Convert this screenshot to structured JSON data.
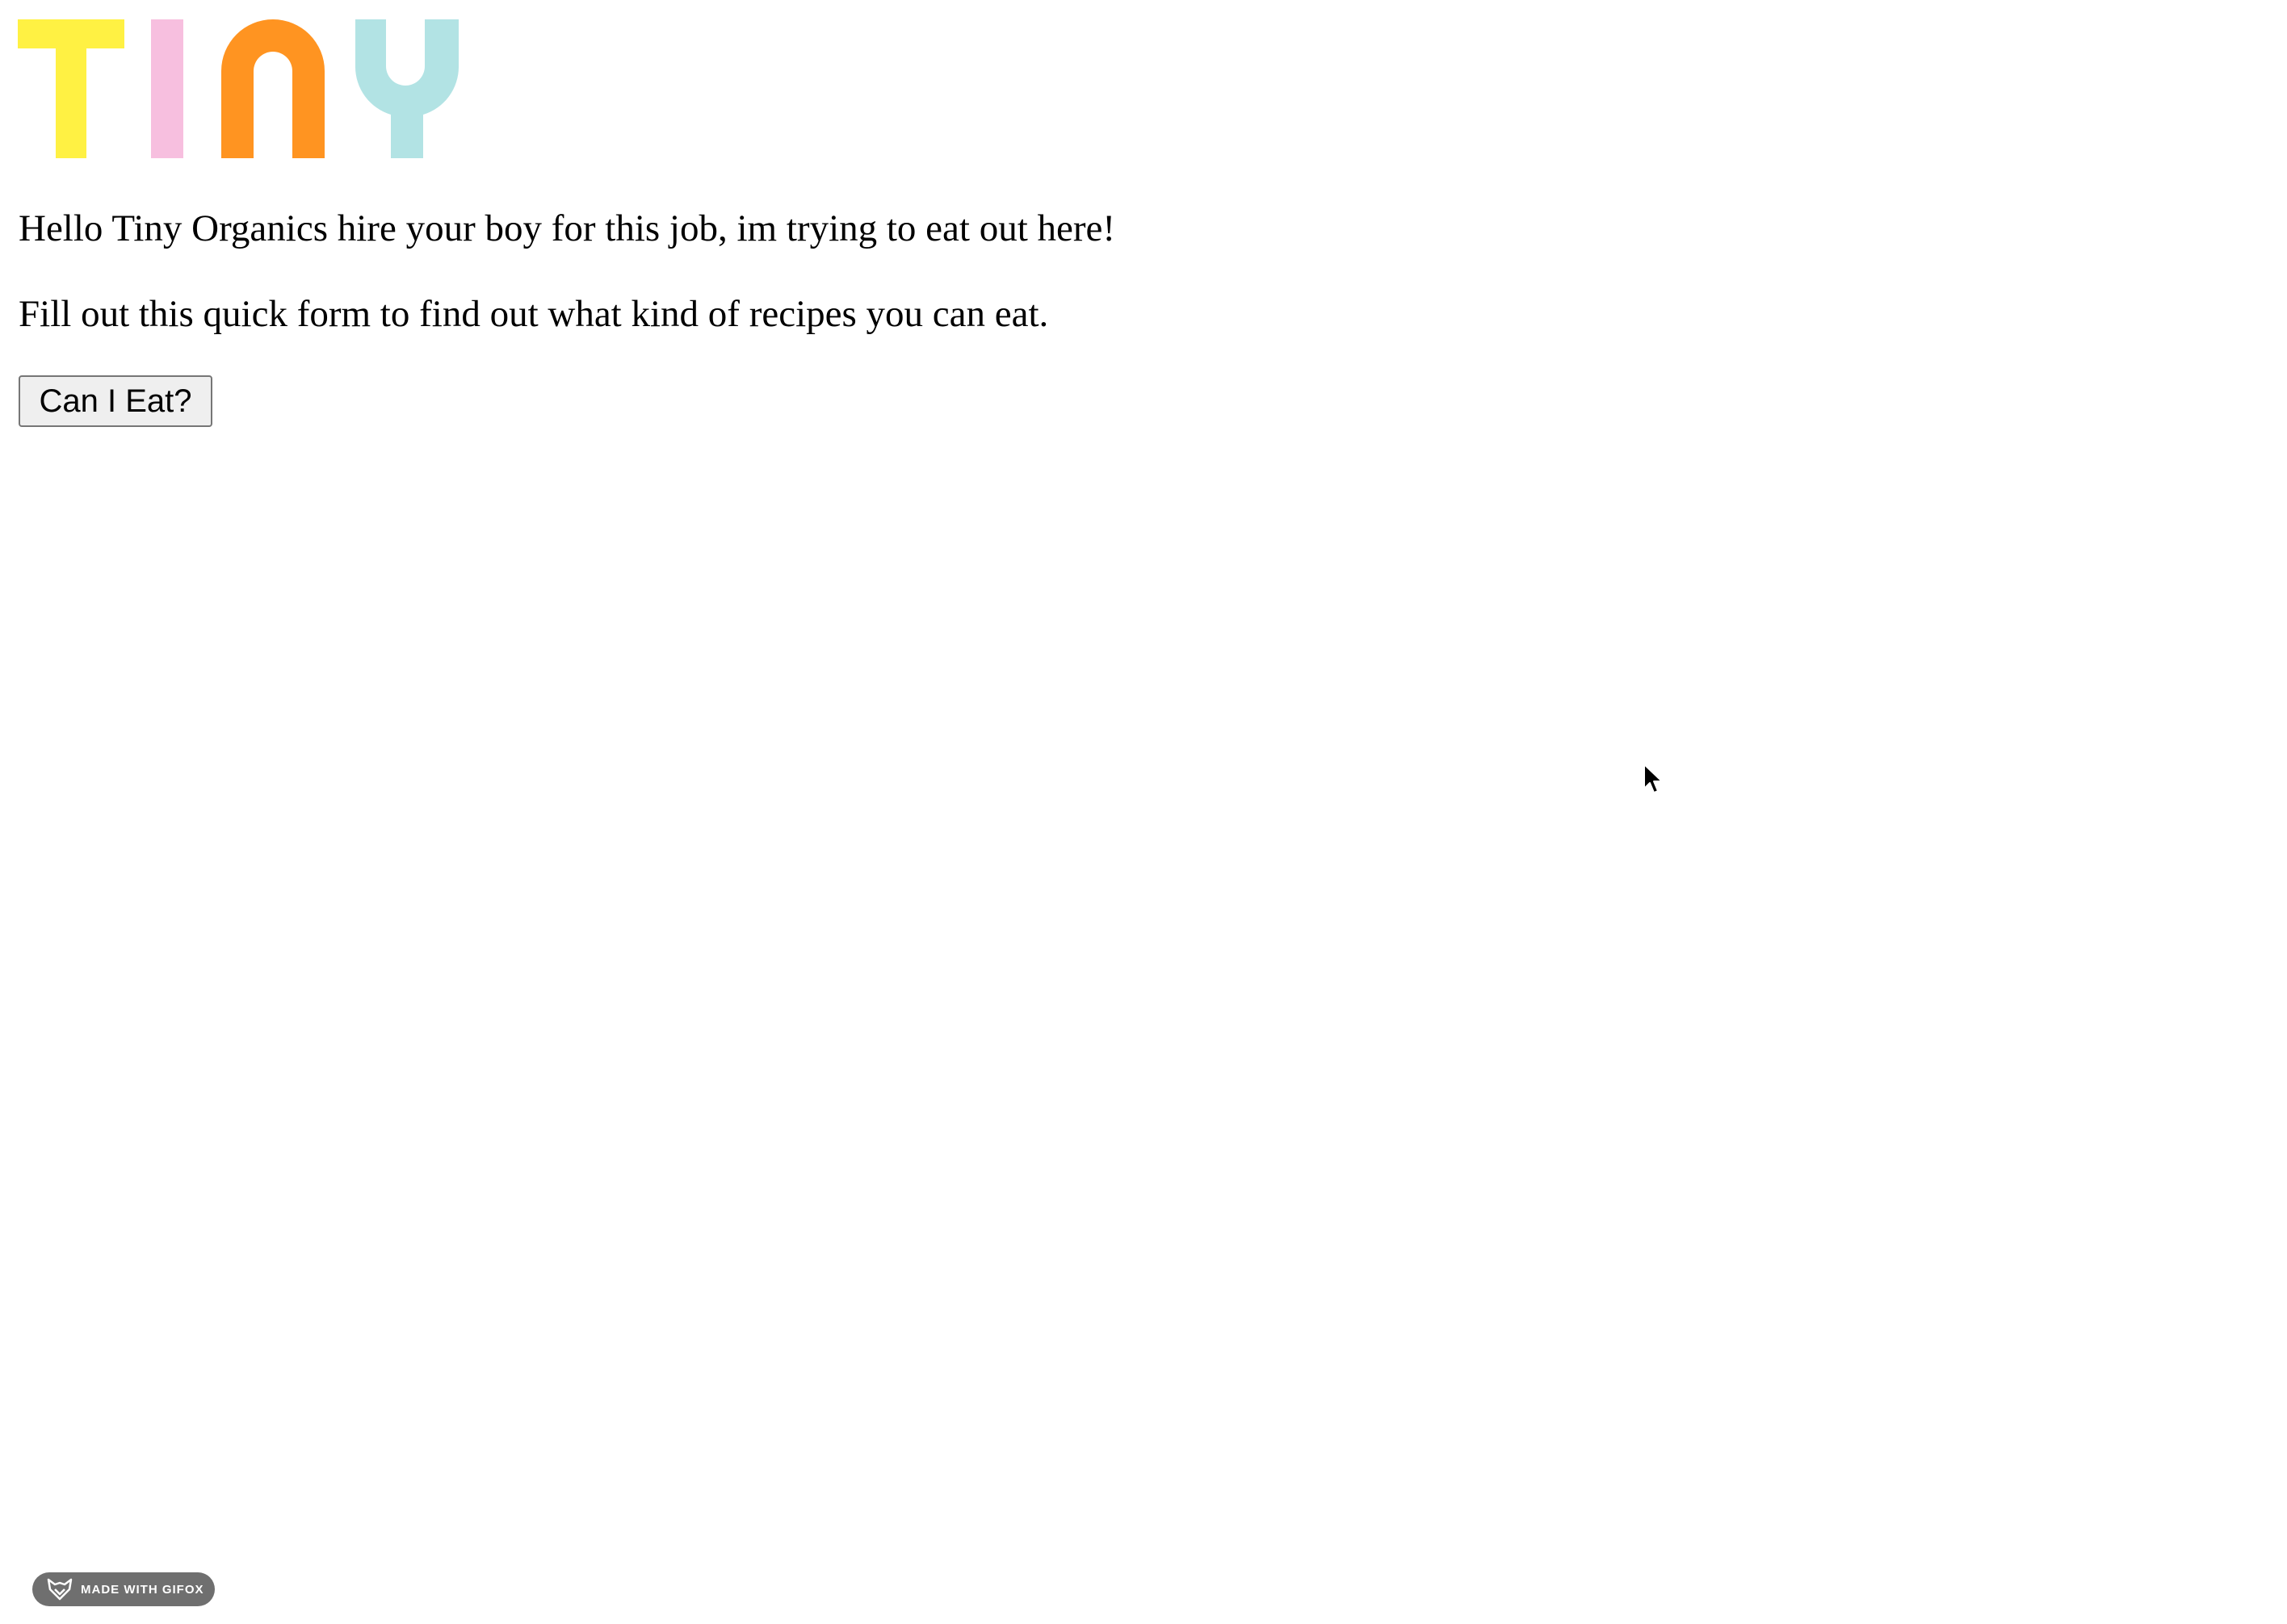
{
  "logo": {
    "text": "TINY",
    "letters": [
      {
        "char": "T",
        "color": "#FFF143"
      },
      {
        "char": "I",
        "color": "#F7BFDF"
      },
      {
        "char": "N",
        "color": "#FF9421"
      },
      {
        "char": "Y",
        "color": "#B2E3E4"
      }
    ]
  },
  "intro": {
    "greeting": "Hello Tiny Organics hire your boy for this job, im trying to eat out here!",
    "instruction": "Fill out this quick form to find out what kind of recipes you can eat."
  },
  "form": {
    "start_button_label": "Can I Eat?"
  },
  "watermark": {
    "text": "MADE WITH GIFOX",
    "icon": "fox-icon"
  },
  "pointer": {
    "icon": "mouse-cursor-icon"
  }
}
